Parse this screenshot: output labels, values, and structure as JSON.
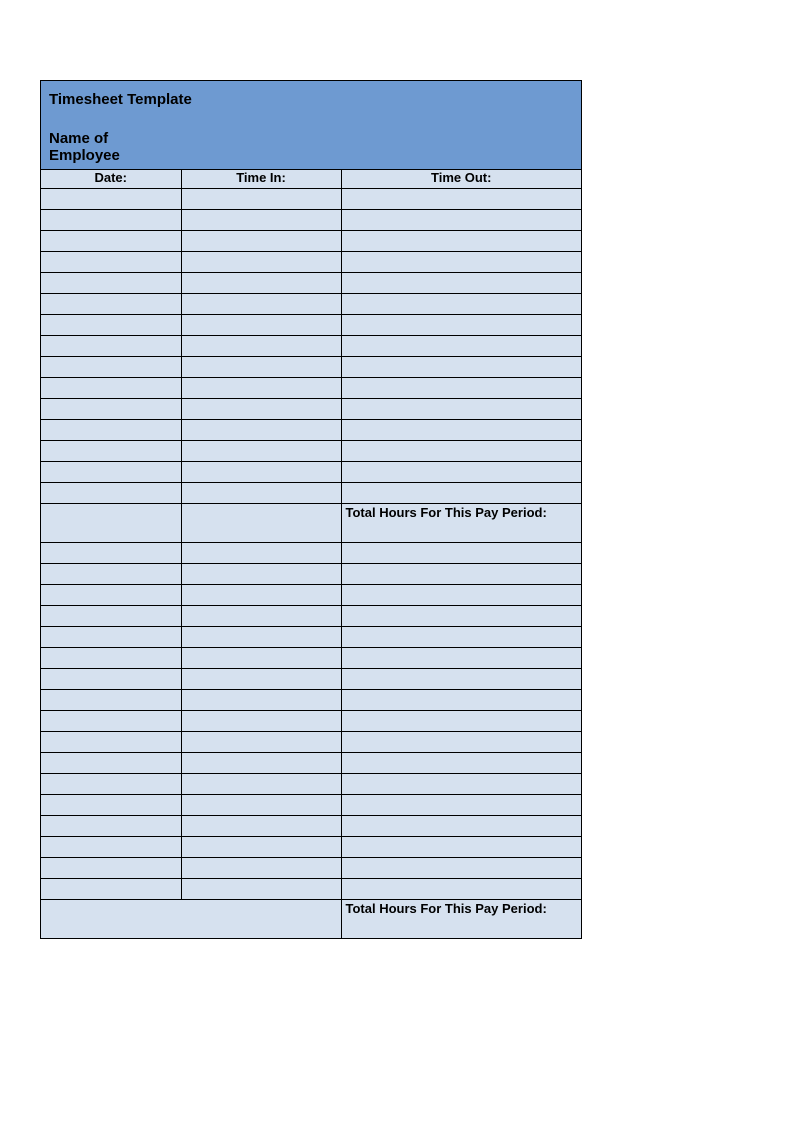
{
  "header": {
    "title": "Timesheet Template",
    "employee_label": "Name of Employee"
  },
  "columns": {
    "date": "Date:",
    "time_in": "Time In:",
    "time_out": "Time Out:"
  },
  "total_label_1": "Total Hours For This Pay Period:",
  "total_label_2": "Total Hours For This Pay Period:"
}
